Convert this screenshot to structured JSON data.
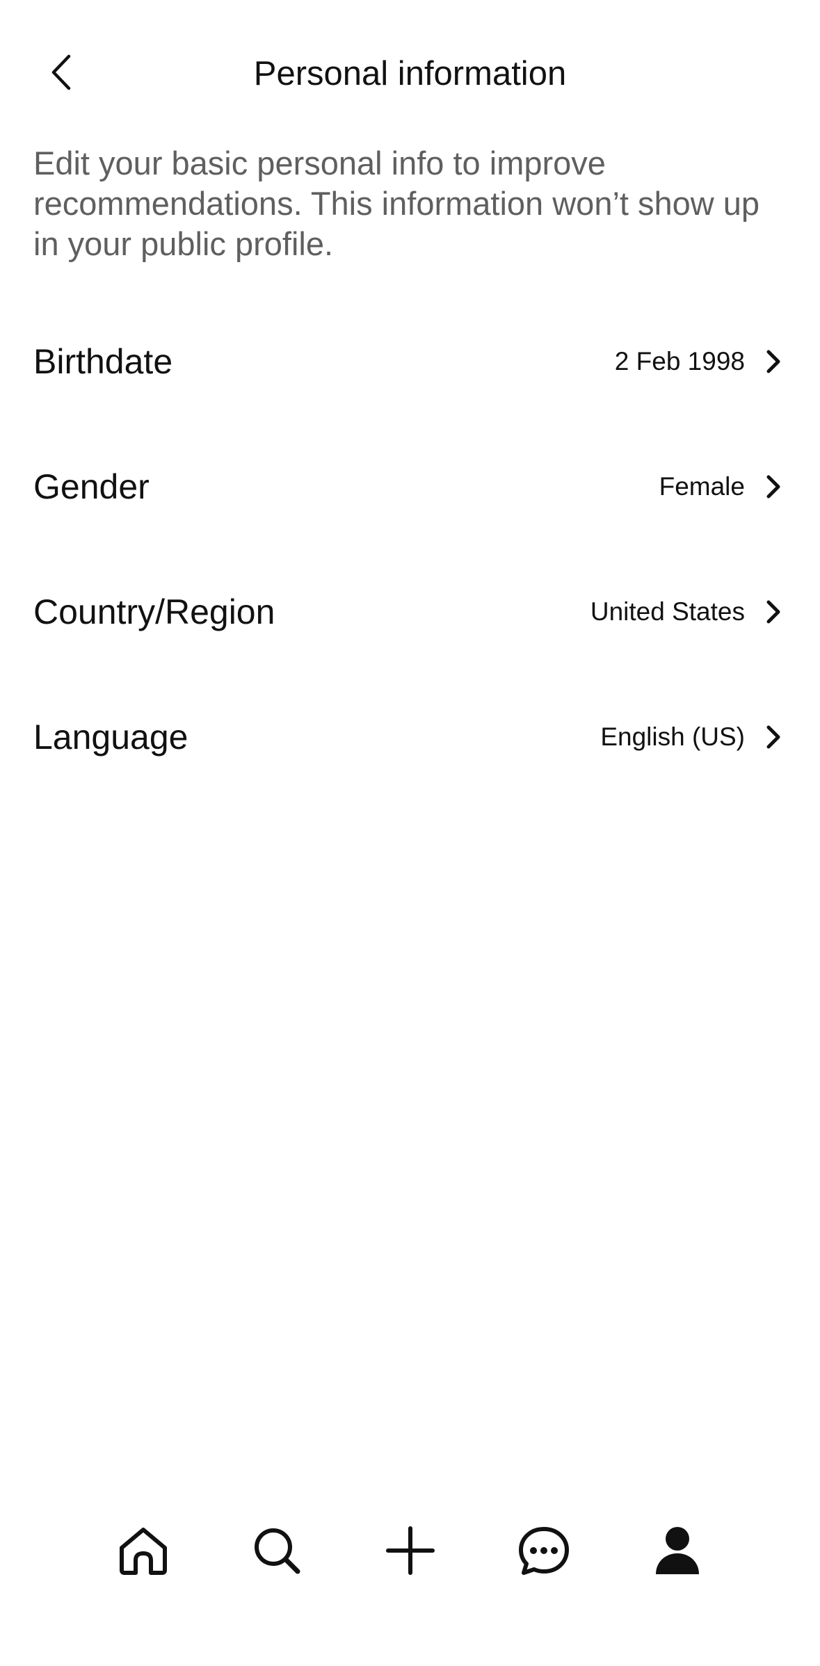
{
  "header": {
    "title": "Personal information",
    "back_icon": "chevron-left-icon"
  },
  "intro_text": "Edit your basic personal info to improve recommendations. This information won’t show up in your public profile.",
  "fields": [
    {
      "label": "Birthdate",
      "value": "2 Feb 1998"
    },
    {
      "label": "Gender",
      "value": "Female"
    },
    {
      "label": "Country/Region",
      "value": "United States"
    },
    {
      "label": "Language",
      "value": "English (US)"
    }
  ],
  "bottom_nav": {
    "items": [
      "home-icon",
      "search-icon",
      "create-plus-icon",
      "messages-icon",
      "profile-icon"
    ],
    "active": "profile-icon"
  },
  "colors": {
    "text": "#111111",
    "secondary_text": "#5f5f5f",
    "background": "#ffffff"
  }
}
